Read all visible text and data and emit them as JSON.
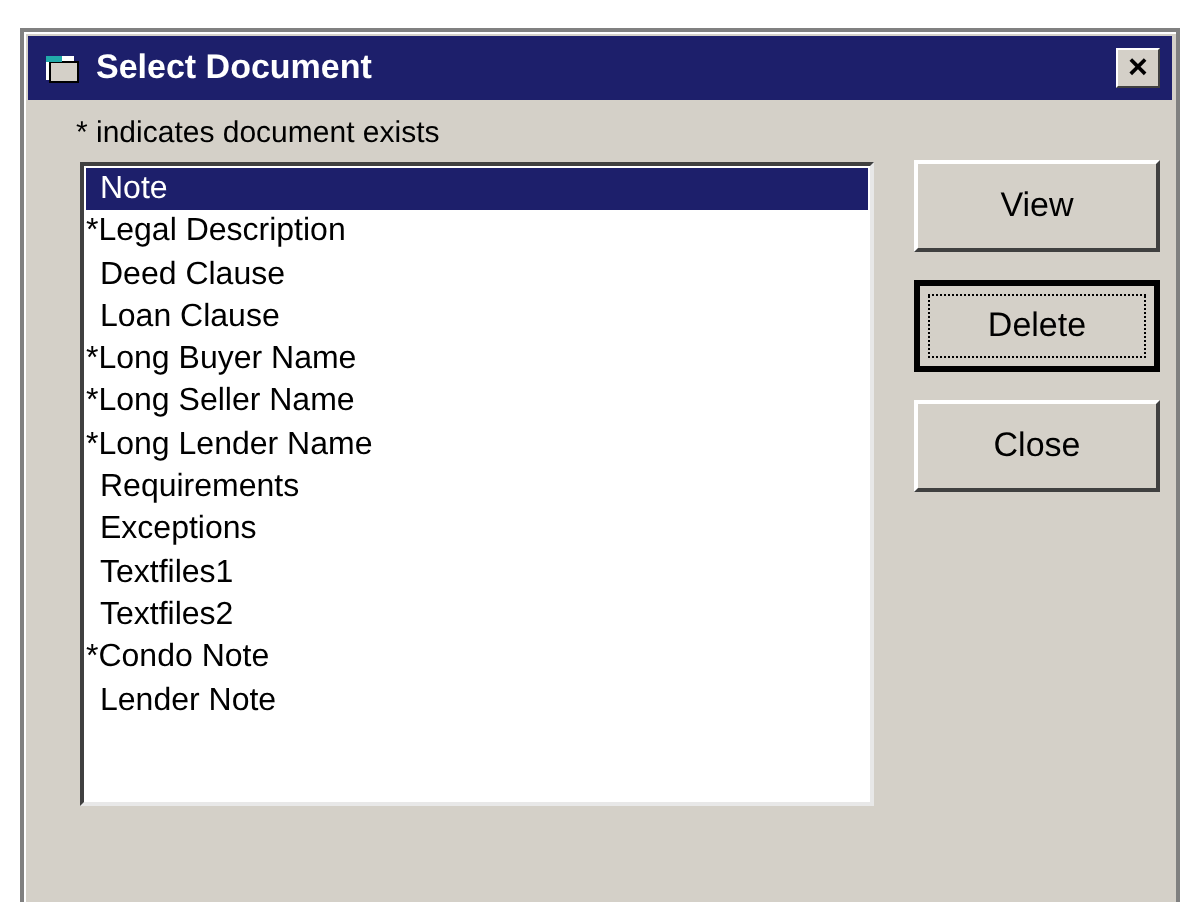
{
  "window": {
    "title": "Select Document",
    "close": "×"
  },
  "hint": "* indicates document exists",
  "documents": [
    {
      "label": "Note",
      "selected": true
    },
    {
      "label": "*Legal Description",
      "selected": false
    },
    {
      "label": "Deed Clause",
      "selected": false
    },
    {
      "label": "Loan Clause",
      "selected": false
    },
    {
      "label": "*Long Buyer Name",
      "selected": false
    },
    {
      "label": "*Long Seller Name",
      "selected": false
    },
    {
      "label": "*Long Lender Name",
      "selected": false
    },
    {
      "label": "Requirements",
      "selected": false
    },
    {
      "label": "Exceptions",
      "selected": false
    },
    {
      "label": "Textfiles1",
      "selected": false
    },
    {
      "label": "Textfiles2",
      "selected": false
    },
    {
      "label": "*Condo Note",
      "selected": false
    },
    {
      "label": "Lender Note",
      "selected": false
    }
  ],
  "buttons": [
    {
      "label": "View",
      "focused": false
    },
    {
      "label": "Delete",
      "focused": true
    },
    {
      "label": "Close",
      "focused": false
    }
  ]
}
